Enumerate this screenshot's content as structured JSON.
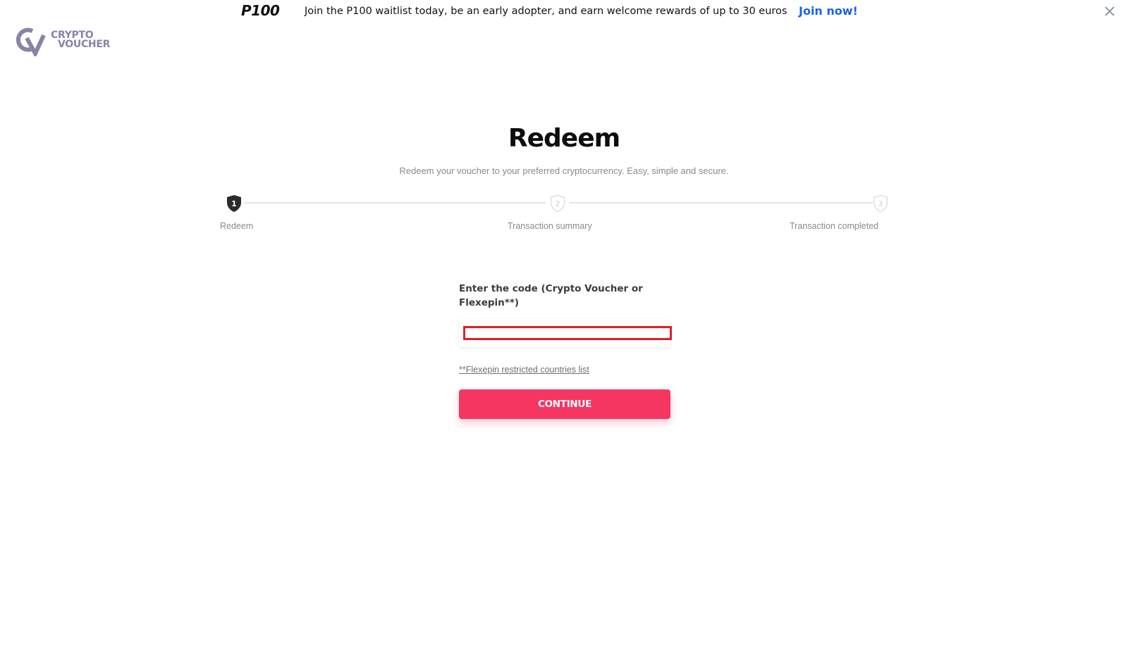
{
  "banner": {
    "logo_text": "P100",
    "message": "Join the P100 waitlist today, be an early adopter, and earn welcome rewards of up to 30 euros",
    "cta": "Join now!",
    "close_icon": "close-icon"
  },
  "site": {
    "logo_line1": "CRYPTO",
    "logo_line2": "VOUCHER",
    "logo_color": "#8a82a8"
  },
  "main": {
    "title": "Redeem",
    "subtitle": "Redeem your voucher to your preferred cryptocurrency. Easy, simple and secure."
  },
  "stepper": {
    "current_step": 1,
    "steps": [
      {
        "number": "1",
        "label": "Redeem",
        "state": "active"
      },
      {
        "number": "2",
        "label": "Transaction summary",
        "state": "inactive"
      },
      {
        "number": "3",
        "label": "Transaction completed",
        "state": "inactive"
      }
    ]
  },
  "form": {
    "code_label": "Enter the code (Crypto Voucher or Flexepin**)",
    "code_value": "",
    "code_placeholder": "",
    "restricted_link": "**Flexepin restricted countries list",
    "continue_label": "CONTINUE"
  },
  "colors": {
    "accent": "#f53661",
    "link_blue": "#1a62e8",
    "input_highlight": "#e01f2a"
  }
}
